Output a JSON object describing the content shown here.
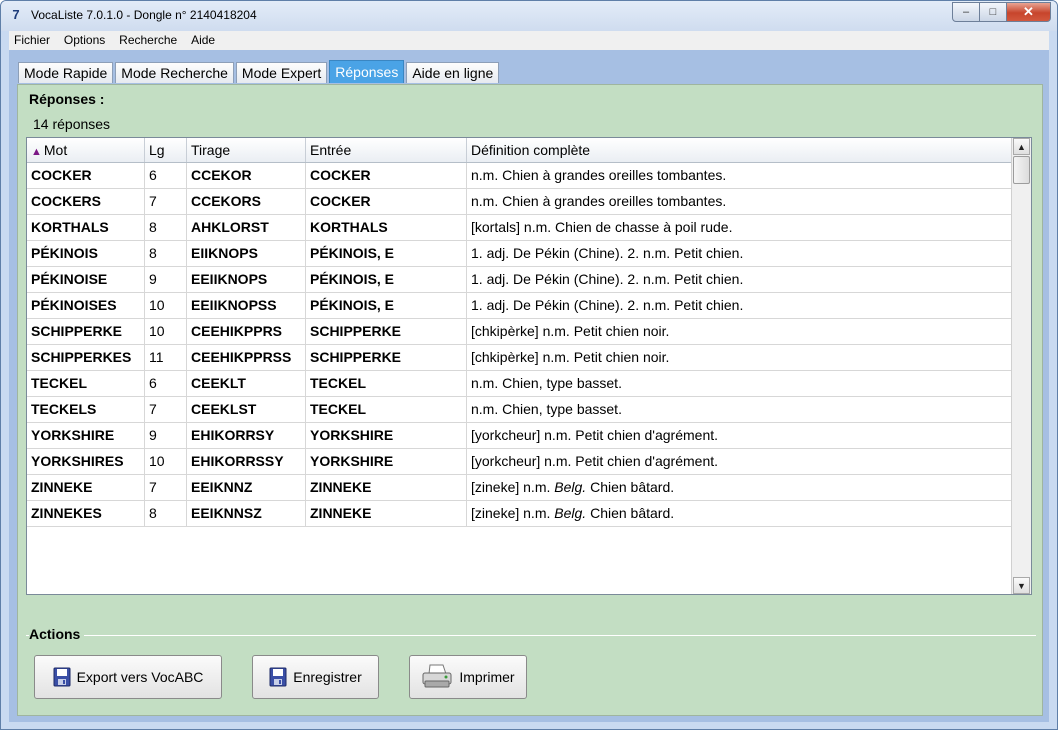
{
  "window": {
    "icon_glyph": "7",
    "title": "VocaListe 7.0.1.0 - Dongle n° 2140418204",
    "minimize_glyph": "–",
    "maximize_glyph": "□",
    "close_glyph": "✕"
  },
  "menu": [
    "Fichier",
    "Options",
    "Recherche",
    "Aide"
  ],
  "tabs": [
    "Mode Rapide",
    "Mode Recherche",
    "Mode Expert",
    "Réponses",
    "Aide en ligne"
  ],
  "active_tab": "Réponses",
  "responses": {
    "group_label": "Réponses :",
    "count_text": "14 réponses",
    "sort_arrow": "▲",
    "columns": [
      "Mot",
      "Lg",
      "Tirage",
      "Entrée",
      "Définition complète"
    ],
    "rows": [
      [
        "COCKER",
        "6",
        "CCEKOR",
        "COCKER",
        "n.m. Chien à grandes oreilles tombantes."
      ],
      [
        "COCKERS",
        "7",
        "CCEKORS",
        "COCKER",
        "n.m. Chien à grandes oreilles tombantes."
      ],
      [
        "KORTHALS",
        "8",
        "AHKLORST",
        "KORTHALS",
        "[kortals] n.m. Chien de chasse à poil rude."
      ],
      [
        "PÉKINOIS",
        "8",
        "EIIKNOPS",
        "PÉKINOIS, E",
        "1. adj. De Pékin (Chine). 2. n.m. Petit chien."
      ],
      [
        "PÉKINOISE",
        "9",
        "EEIIKNOPS",
        "PÉKINOIS, E",
        "1. adj. De Pékin (Chine). 2. n.m. Petit chien."
      ],
      [
        "PÉKINOISES",
        "10",
        "EEIIKNOPSS",
        "PÉKINOIS, E",
        "1. adj. De Pékin (Chine). 2. n.m. Petit chien."
      ],
      [
        "SCHIPPERKE",
        "10",
        "CEEHIKPPRS",
        "SCHIPPERKE",
        "[chkipèrke] n.m. Petit chien noir."
      ],
      [
        "SCHIPPERKES",
        "11",
        "CEEHIKPPRSS",
        "SCHIPPERKE",
        "[chkipèrke] n.m. Petit chien noir."
      ],
      [
        "TECKEL",
        "6",
        "CEEKLT",
        "TECKEL",
        "n.m. Chien, type basset."
      ],
      [
        "TECKELS",
        "7",
        "CEEKLST",
        "TECKEL",
        "n.m. Chien, type basset."
      ],
      [
        "YORKSHIRE",
        "9",
        "EHIKORRSY",
        "YORKSHIRE",
        "[yorkcheur] n.m. Petit chien d'agrément."
      ],
      [
        "YORKSHIRES",
        "10",
        "EHIKORRSSY",
        "YORKSHIRE",
        "[yorkcheur] n.m. Petit chien d'agrément."
      ],
      [
        "ZINNEKE",
        "7",
        "EEIKNNZ",
        "ZINNEKE",
        "[zineke] n.m. Belg. Chien bâtard."
      ],
      [
        "ZINNEKES",
        "8",
        "EEIKNNSZ",
        "ZINNEKE",
        "[zineke] n.m. Belg. Chien bâtard."
      ]
    ],
    "scroll_up_glyph": "▲",
    "scroll_down_glyph": "▼"
  },
  "actions": {
    "group_label": "Actions",
    "export_label": "Export vers VocABC",
    "save_label": "Enregistrer",
    "print_label": "Imprimer"
  },
  "colors": {
    "active_tab": "#4aa3e6",
    "panel_bg": "#c3dec3",
    "client_bg": "#a6bfe3",
    "sort_arrow": "#7b1785"
  }
}
